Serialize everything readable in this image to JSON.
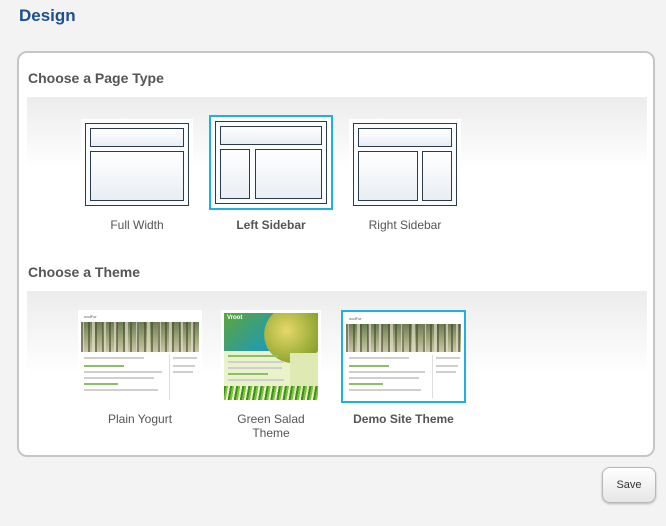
{
  "page": {
    "title": "Design"
  },
  "page_type": {
    "heading": "Choose a Page Type",
    "options": [
      {
        "label": "Full Width",
        "selected": false
      },
      {
        "label": "Left Sidebar",
        "selected": true
      },
      {
        "label": "Right Sidebar",
        "selected": false
      }
    ]
  },
  "theme": {
    "heading": "Choose a Theme",
    "options": [
      {
        "label": "Plain Yogurt",
        "selected": false
      },
      {
        "label": "Green Salad Theme",
        "selected": false
      },
      {
        "label": "Demo Site Theme",
        "selected": true
      }
    ],
    "preview_text": {
      "site_name": "oodFor",
      "green_site_name": "Vroot"
    }
  },
  "actions": {
    "save_label": "Save"
  },
  "colors": {
    "title": "#1d4f91",
    "selected_border": "#1fb1d9",
    "panel_border": "#c6c6c6"
  }
}
